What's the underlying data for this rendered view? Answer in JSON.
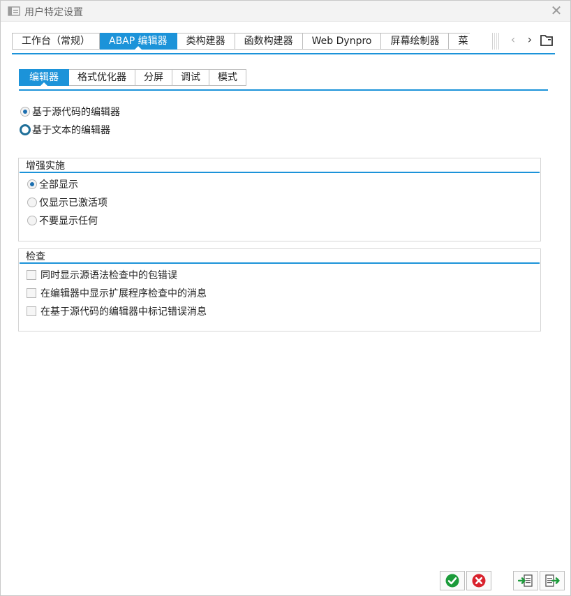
{
  "window": {
    "title": "用户特定设置"
  },
  "top_tabs": [
    {
      "label": "工作台（常规）",
      "active": false
    },
    {
      "label": "ABAP 编辑器",
      "active": true
    },
    {
      "label": "类构建器",
      "active": false
    },
    {
      "label": "函数构建器",
      "active": false
    },
    {
      "label": "Web Dynpro",
      "active": false
    },
    {
      "label": "屏幕绘制器",
      "active": false
    },
    {
      "label": "菜",
      "active": false
    }
  ],
  "sub_tabs": [
    {
      "label": "编辑器",
      "active": true
    },
    {
      "label": "格式优化器",
      "active": false
    },
    {
      "label": "分屏",
      "active": false
    },
    {
      "label": "调试",
      "active": false
    },
    {
      "label": "模式",
      "active": false
    }
  ],
  "editor_mode": {
    "options": [
      {
        "label": "基于源代码的编辑器",
        "selected": true
      },
      {
        "label": "基于文本的编辑器",
        "selected": false,
        "focused": true
      }
    ]
  },
  "enhancement_group": {
    "title": "增强实施",
    "options": [
      {
        "label": "全部显示",
        "selected": true
      },
      {
        "label": "仅显示已激活项",
        "selected": false
      },
      {
        "label": "不要显示任何",
        "selected": false
      }
    ]
  },
  "check_group": {
    "title": "检查",
    "options": [
      {
        "label": "同时显示源语法检查中的包错误",
        "checked": false
      },
      {
        "label": "在编辑器中显示扩展程序检查中的消息",
        "checked": false
      },
      {
        "label": "在基于源代码的编辑器中标记错误消息",
        "checked": false
      }
    ]
  },
  "colors": {
    "accent": "#1c93d9",
    "confirm": "#1b9b3a",
    "cancel": "#d9232e"
  },
  "icons": {
    "confirm": "check-circle-icon",
    "cancel": "x-circle-icon",
    "import": "import-settings-icon",
    "export": "export-settings-icon"
  }
}
